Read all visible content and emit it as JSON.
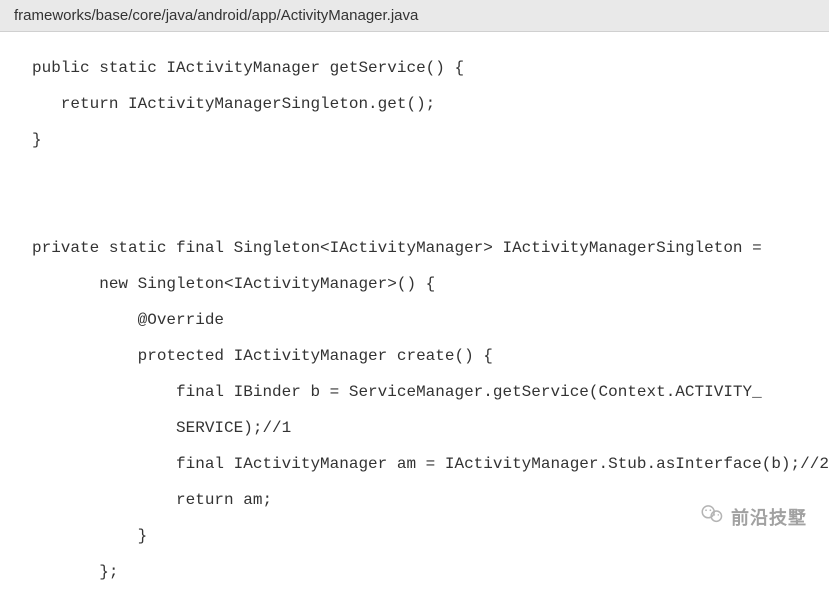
{
  "file_path": "frameworks/base/core/java/android/app/ActivityManager.java",
  "code_lines": [
    "public static IActivityManager getService() {",
    "   return IActivityManagerSingleton.get();",
    "}",
    "",
    "",
    "private static final Singleton<IActivityManager> IActivityManagerSingleton =",
    "       new Singleton<IActivityManager>() {",
    "           @Override",
    "           protected IActivityManager create() {",
    "               final IBinder b = ServiceManager.getService(Context.ACTIVITY_",
    "               SERVICE);//1",
    "               final IActivityManager am = IActivityManager.Stub.asInterface(b);//2",
    "               return am;",
    "           }",
    "       };"
  ],
  "watermark_text": "前沿技墅"
}
